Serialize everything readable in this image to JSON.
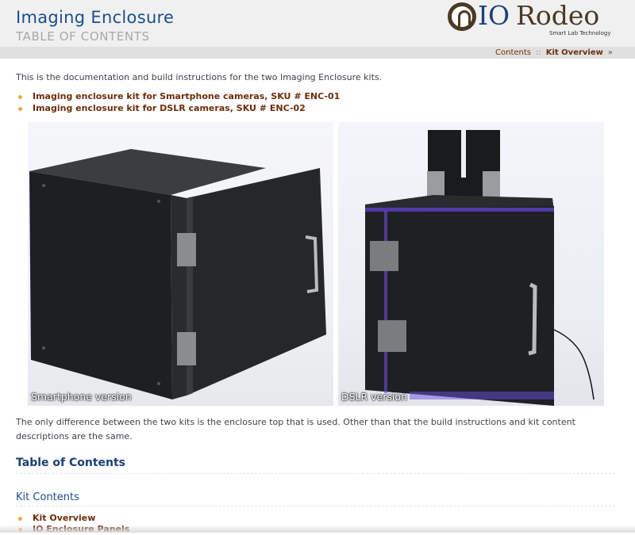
{
  "header": {
    "title": "Imaging Enclosure",
    "subtitle": "TABLE OF CONTENTS",
    "logo": {
      "io": "IO",
      "rodeo": "Rodeo",
      "tagline": "Smart Lab Technology"
    }
  },
  "relbar": {
    "contents": "Contents",
    "separator": "::",
    "current": "Kit Overview",
    "raquo": "»"
  },
  "intro": "This is the documentation and build instructions for the two Imaging Enclosure kits.",
  "kits": [
    "Imaging enclosure kit for Smartphone cameras, SKU # ENC-01",
    "Imaging enclosure kit for DSLR cameras, SKU # ENC-02"
  ],
  "photos": [
    {
      "caption": "Smartphone version"
    },
    {
      "caption": "DSLR version"
    }
  ],
  "paragraph": "The only difference between the two kits is the enclosure top that is used. Other than that the build instructions and kit content descriptions are the same.",
  "toc_heading": "Table of Contents",
  "kit_contents_heading": "Kit Contents",
  "kit_contents_items": [
    "Kit Overview",
    "IO Enclosure Panels"
  ],
  "colors": {
    "link": "#6d2d0b",
    "heading": "#1c3f78",
    "bullet": "#f2a34a",
    "header_bg": "#f0f0f0"
  }
}
